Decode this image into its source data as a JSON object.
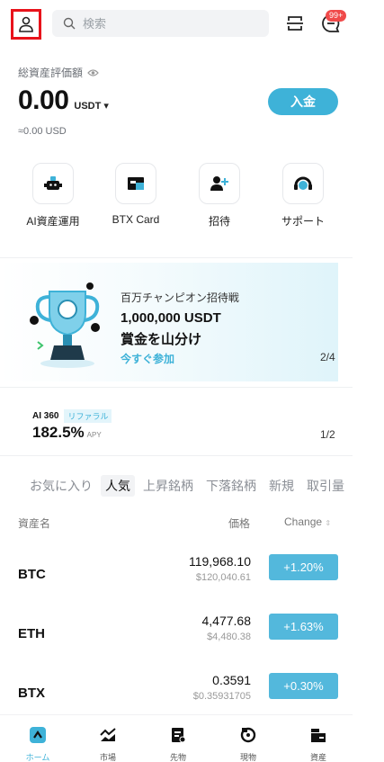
{
  "header": {
    "search_placeholder": "検索",
    "message_badge": "99+",
    "accent_color": "#3eb2d8"
  },
  "balance": {
    "label": "総資産評価額",
    "value": "0.00",
    "unit": "USDT",
    "sub": "≈0.00 USD",
    "deposit_label": "入金"
  },
  "quick_menu": [
    {
      "label": "AI資産運用",
      "icon": "robot-icon"
    },
    {
      "label": "BTX Card",
      "icon": "card-icon"
    },
    {
      "label": "招待",
      "icon": "invite-user-icon"
    },
    {
      "label": "サポート",
      "icon": "support-headset-icon"
    }
  ],
  "banner": {
    "title": "百万チャンピオン招待戦",
    "amount": "1,000,000 USDT",
    "text": "賞金を山分け",
    "link": "今すぐ参加",
    "page": "2/4"
  },
  "ai_card": {
    "title": "AI 360",
    "tag": "リファラル",
    "rate": "182.5%",
    "rate_unit": "APY",
    "page": "1/2"
  },
  "market_tabs": [
    {
      "label": "お気に入り",
      "active": false
    },
    {
      "label": "人気",
      "active": true
    },
    {
      "label": "上昇銘柄",
      "active": false
    },
    {
      "label": "下落銘柄",
      "active": false
    },
    {
      "label": "新規",
      "active": false
    },
    {
      "label": "取引量",
      "active": false
    }
  ],
  "columns": {
    "asset": "資産名",
    "price": "価格",
    "change": "Change"
  },
  "assets": [
    {
      "symbol": "BTC",
      "price": "119,968.10",
      "fiat": "$120,040.61",
      "change": "+1.20%"
    },
    {
      "symbol": "ETH",
      "price": "4,477.68",
      "fiat": "$4,480.38",
      "change": "+1.63%"
    },
    {
      "symbol": "BTX",
      "price": "0.3591",
      "fiat": "$0.35931705",
      "change": "+0.30%"
    }
  ],
  "bottom_nav": [
    {
      "label": "ホーム",
      "icon": "home-icon",
      "active": true
    },
    {
      "label": "市場",
      "icon": "market-icon",
      "active": false
    },
    {
      "label": "先物",
      "icon": "futures-icon",
      "active": false
    },
    {
      "label": "現物",
      "icon": "spot-icon",
      "active": false
    },
    {
      "label": "資産",
      "icon": "wallet-icon",
      "active": false
    }
  ]
}
